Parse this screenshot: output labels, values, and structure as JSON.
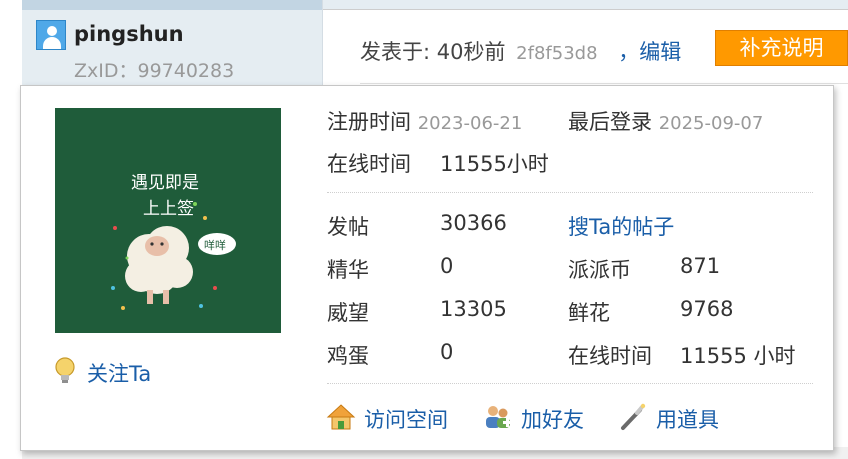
{
  "user": {
    "username": "pingshun",
    "zxid": "ZxID：99740283"
  },
  "post": {
    "posted_label": "发表于: 40秒前",
    "hash": "2f8f53d8",
    "edit_link": "，编辑",
    "supplement_button": "补充说明"
  },
  "card": {
    "avatar_text_line1": "遇见即是",
    "avatar_text_line2": "上上签",
    "avatar_bubble": "咩咩",
    "register_label": "注册时间",
    "register_date": "2023-06-21",
    "last_login_label": "最后登录",
    "last_login_date": "2025-09-07",
    "online_label": "在线时间",
    "online_value": "11555小时",
    "follow_label": "关注Ta",
    "stats": {
      "posts_label": "发帖",
      "posts_value": "30366",
      "search_posts_link": "搜Ta的帖子",
      "digest_label": "精华",
      "digest_value": "0",
      "coins_label": "派派币",
      "coins_value": "871",
      "prestige_label": "威望",
      "prestige_value": "13305",
      "flowers_label": "鲜花",
      "flowers_value": "9768",
      "eggs_label": "鸡蛋",
      "eggs_value": "0",
      "online2_label": "在线时间",
      "online2_value": "11555 小时"
    },
    "actions": {
      "visit_space": "访问空间",
      "add_friend": "加好友",
      "use_item": "用道具"
    }
  },
  "icons": {
    "user_avatar": "user-avatar-icon",
    "follow": "lightbulb-icon",
    "visit_space": "home-icon",
    "add_friend": "add-friend-icon",
    "use_item": "magic-wand-icon"
  },
  "colors": {
    "link": "#1a5ea8",
    "supplement_button_bg": "#ff9900",
    "avatar_bg": "#1f5c3a",
    "sidebar_bg": "#e5edf2"
  }
}
